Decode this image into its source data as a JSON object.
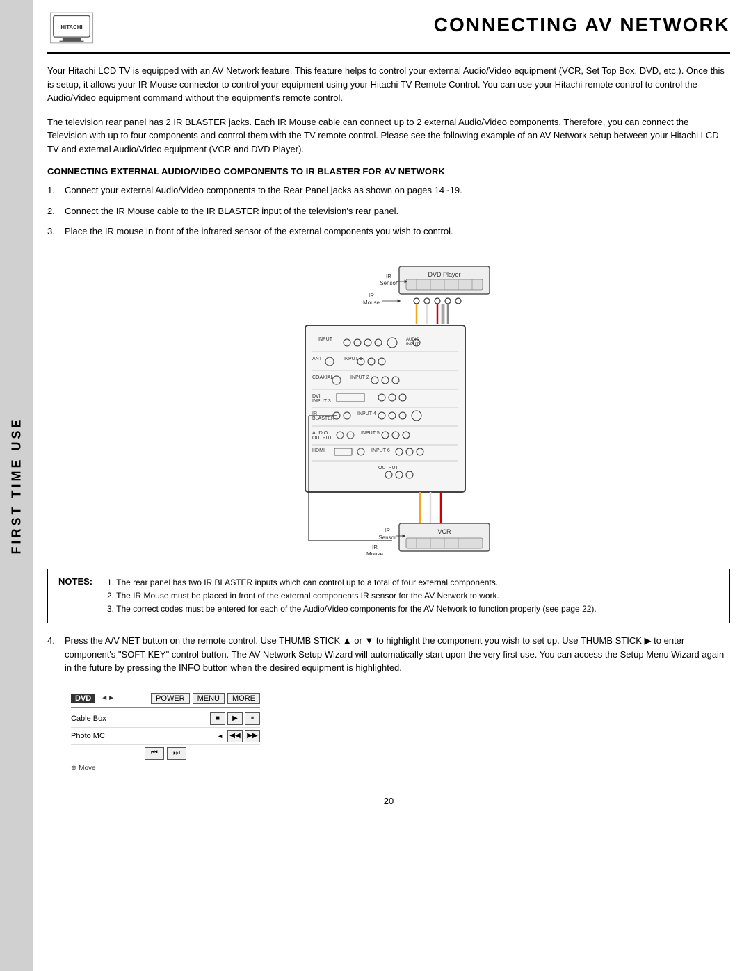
{
  "sidebar": {
    "label": "FIRST TIME USE"
  },
  "header": {
    "title": "CONNECTING AV NETWORK",
    "logo_alt": "Hitachi logo"
  },
  "intro": {
    "text": "Your Hitachi LCD TV is equipped with an AV Network feature.  This feature helps to control your external Audio/Video equipment (VCR, Set Top Box, DVD, etc.).  Once this is setup, it allows your IR Mouse connector to control your equipment using your Hitachi TV Remote Control.  You can use your Hitachi remote control to control the Audio/Video equipment command without the equipment's remote control.",
    "text2": "The television rear panel has 2 IR BLASTER jacks.  Each IR Mouse cable can connect up to 2 external Audio/Video components. Therefore, you can connect the Television with up to four components and control them with the TV remote control.  Please see the following example of an AV Network setup between your Hitachi LCD TV and external Audio/Video equipment (VCR and DVD Player)."
  },
  "section_heading": "CONNECTING EXTERNAL AUDIO/VIDEO COMPONENTS TO IR BLASTER FOR AV NETWORK",
  "steps": [
    {
      "num": "1.",
      "text": "Connect your external Audio/Video components to the Rear Panel jacks as shown on pages 14~19."
    },
    {
      "num": "2.",
      "text": "Connect the IR Mouse cable to the IR BLASTER input of the television's rear panel."
    },
    {
      "num": "3.",
      "text": "Place the IR mouse in front of the infrared sensor of the external components you wish to control."
    }
  ],
  "notes": {
    "label": "NOTES:",
    "items": [
      "1.  The rear panel has two IR BLASTER inputs which can control up to a total of four external components.",
      "2.  The IR Mouse must be placed in front of the external components IR sensor for the AV Network to work.",
      "3.  The correct codes must be entered for each of the Audio/Video components for the AV Network to function properly (see page 22)."
    ]
  },
  "step4": {
    "num": "4.",
    "text1": "Press the A/V NET button on the remote control.  Use THUMB STICK ▲ or ▼ to highlight the component you wish to set up.  Use THUMB STICK ▶ to enter component's \"SOFT KEY\" control button.  The AV Network Setup Wizard will automatically start upon the very first use.  You can access the Setup Menu Wizard again in the future by pressing the INFO button when the desired equipment is highlighted."
  },
  "ui_mockup": {
    "dvd_label": "DVD",
    "arrow_indicator": "◄►",
    "buttons": [
      "POWER",
      "MENU",
      "MORE"
    ],
    "rows": [
      {
        "name": "Cable Box",
        "arrow": "",
        "controls": [
          "■",
          "▶",
          "⏸"
        ]
      },
      {
        "name": "Photo MC",
        "arrow": "◄",
        "controls": [
          "◀◀",
          "▶▶"
        ]
      }
    ],
    "nav_row": [
      "⏮",
      "⏭"
    ],
    "footer": "⊕ Move"
  },
  "diagram": {
    "dvd_label": "DVD Player",
    "vcr_label": "VCR",
    "ir_sensor_label": "IR Sensor",
    "ir_mouse_label": "IR Mouse"
  },
  "page_number": "20"
}
